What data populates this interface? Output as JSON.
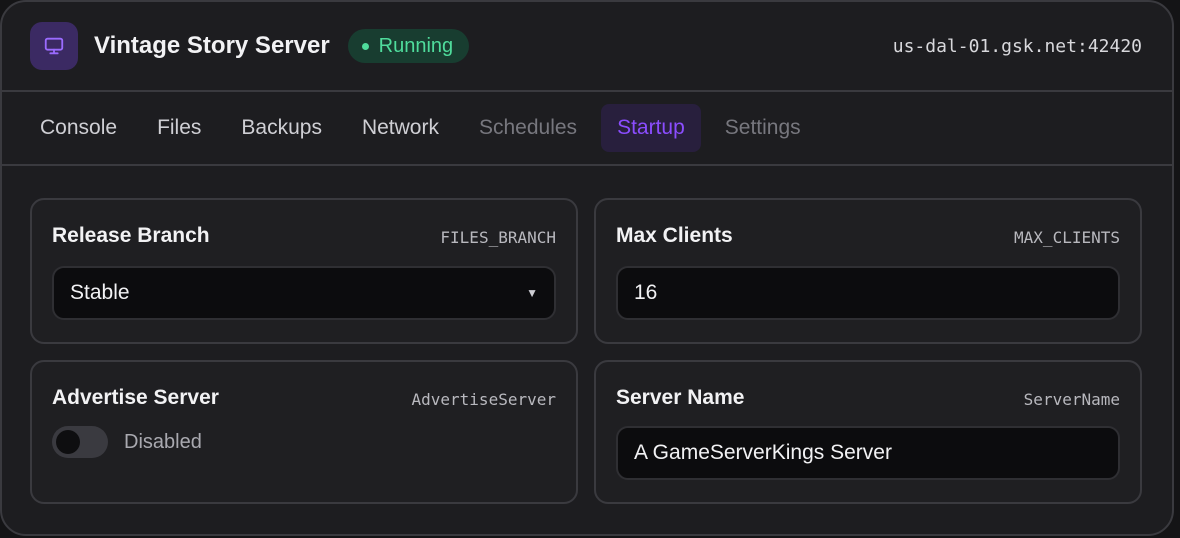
{
  "header": {
    "app_icon": "monitor-icon",
    "title": "Vintage Story Server",
    "status": "Running",
    "status_color": "#4fdc9c",
    "address": "us-dal-01.gsk.net:42420"
  },
  "tabs": [
    {
      "label": "Console",
      "state": "normal"
    },
    {
      "label": "Files",
      "state": "normal"
    },
    {
      "label": "Backups",
      "state": "normal"
    },
    {
      "label": "Network",
      "state": "normal"
    },
    {
      "label": "Schedules",
      "state": "dim"
    },
    {
      "label": "Startup",
      "state": "active"
    },
    {
      "label": "Settings",
      "state": "dim"
    }
  ],
  "accent_color": "#8b4dff",
  "cards": {
    "release_branch": {
      "title": "Release Branch",
      "var": "FILES_BRANCH",
      "value": "Stable"
    },
    "max_clients": {
      "title": "Max Clients",
      "var": "MAX_CLIENTS",
      "value": "16"
    },
    "advertise_server": {
      "title": "Advertise Server",
      "var": "AdvertiseServer",
      "toggle_label": "Disabled",
      "enabled": false
    },
    "server_name": {
      "title": "Server Name",
      "var": "ServerName",
      "value": "A GameServerKings Server"
    }
  }
}
